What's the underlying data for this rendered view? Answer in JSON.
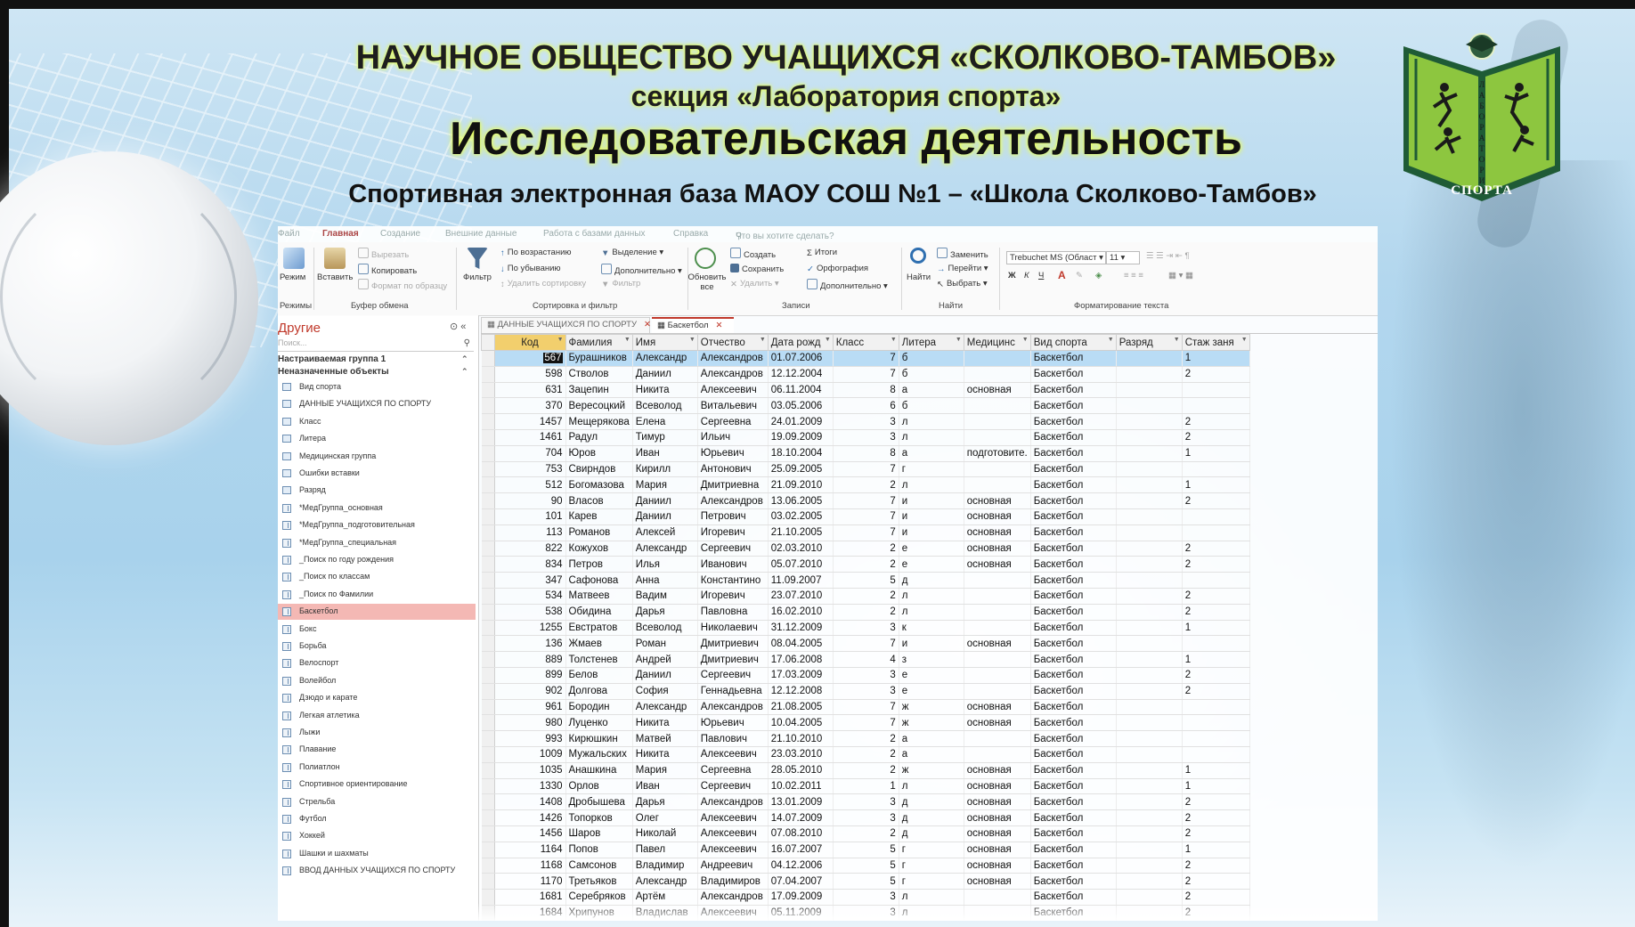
{
  "titles": {
    "line1": "НАУЧНОЕ ОБЩЕСТВО УЧАЩИХСЯ «СКОЛКОВО-ТАМБОВ»",
    "line2": "секция «Лаборатория спорта»",
    "line3": "Исследовательская деятельность",
    "line4": "Спортивная электронная база МАОУ СОШ №1 – «Школа Сколково-Тамбов»"
  },
  "logo": {
    "caption": "СПОРТА",
    "vertical_text": "ЛАБОРАТОРИЯ"
  },
  "ribbon": {
    "tabs": [
      "Файл",
      "Главная",
      "Создание",
      "Внешние данные",
      "Работа с базами данных",
      "Справка",
      "Что вы хотите сделать?"
    ],
    "active_tab": "Главная",
    "views": {
      "label": "Режим",
      "group": "Режимы"
    },
    "clipboard": {
      "paste": "Вставить",
      "cut": "Вырезать",
      "copy": "Копировать",
      "format": "Формат по образцу",
      "group": "Буфер обмена"
    },
    "sort": {
      "filter": "Фильтр",
      "asc": "По возрастанию",
      "desc": "По убыванию",
      "remove": "Удалить сортировку",
      "selection": "Выделение",
      "advanced": "Дополнительно",
      "toggle": "Фильтр",
      "group": "Сортировка и фильтр"
    },
    "records": {
      "refresh": "Обновить все",
      "new": "Создать",
      "save": "Сохранить",
      "delete": "Удалить",
      "totals": "Итоги",
      "spelling": "Орфография",
      "more": "Дополнительно",
      "group": "Записи"
    },
    "find": {
      "find": "Найти",
      "replace": "Заменить",
      "goto": "Перейти",
      "select": "Выбрать",
      "group": "Найти"
    },
    "text": {
      "font": "Trebuchet MS (Област",
      "size": "11",
      "bold": "Ж",
      "italic": "К",
      "underline": "Ч",
      "group": "Форматирование текста"
    }
  },
  "nav": {
    "title": "Другие",
    "search_placeholder": "Поиск...",
    "groups": [
      "Настраиваемая группа 1",
      "Неназначенные объекты"
    ],
    "items": [
      {
        "label": "Вид спорта",
        "kind": "table"
      },
      {
        "label": "ДАННЫЕ УЧАЩИХСЯ ПО СПОРТУ",
        "kind": "table"
      },
      {
        "label": "Класс",
        "kind": "table"
      },
      {
        "label": "Литера",
        "kind": "table"
      },
      {
        "label": "Медицинская группа",
        "kind": "table"
      },
      {
        "label": "Ошибки вставки",
        "kind": "table"
      },
      {
        "label": "Разряд",
        "kind": "table"
      },
      {
        "label": "*МедГруппа_основная",
        "kind": "query"
      },
      {
        "label": "*МедГруппа_подготовительная",
        "kind": "query"
      },
      {
        "label": "*МедГруппа_специальная",
        "kind": "query"
      },
      {
        "label": "_Поиск по году рождения",
        "kind": "query"
      },
      {
        "label": "_Поиск по классам",
        "kind": "query"
      },
      {
        "label": "_Поиск по Фамилии",
        "kind": "query"
      },
      {
        "label": "Баскетбол",
        "kind": "query",
        "selected": true
      },
      {
        "label": "Бокс",
        "kind": "query"
      },
      {
        "label": "Борьба",
        "kind": "query"
      },
      {
        "label": "Велоспорт",
        "kind": "query"
      },
      {
        "label": "Волейбол",
        "kind": "query"
      },
      {
        "label": "Дзюдо и карате",
        "kind": "query"
      },
      {
        "label": "Легкая атлетика",
        "kind": "query"
      },
      {
        "label": "Лыжи",
        "kind": "query"
      },
      {
        "label": "Плавание",
        "kind": "query"
      },
      {
        "label": "Полиатлон",
        "kind": "query"
      },
      {
        "label": "Спортивное ориентирование",
        "kind": "query"
      },
      {
        "label": "Стрельба",
        "kind": "query"
      },
      {
        "label": "Футбол",
        "kind": "query"
      },
      {
        "label": "Хоккей",
        "kind": "query"
      },
      {
        "label": "Шашки и шахматы",
        "kind": "query"
      },
      {
        "label": "ВВОД ДАННЫХ УЧАЩИХСЯ ПО СПОРТУ",
        "kind": "query"
      }
    ]
  },
  "doc_tabs": [
    {
      "label": "ДАННЫЕ УЧАЩИХСЯ ПО СПОРТУ",
      "active": false
    },
    {
      "label": "Баскетбол",
      "active": true
    }
  ],
  "grid": {
    "columns": [
      "Код",
      "Фамилия",
      "Имя",
      "Отчество",
      "Дата рожд",
      "Класс",
      "Литера",
      "Медицинс",
      "Вид спорта",
      "Разряд",
      "Стаж заня"
    ],
    "rows": [
      [
        "567",
        "Бурашников",
        "Александр",
        "Александров",
        "01.07.2006",
        "7",
        "б",
        "",
        "Баскетбол",
        "",
        "1"
      ],
      [
        "598",
        "Стволов",
        "Даниил",
        "Александров",
        "12.12.2004",
        "7",
        "б",
        "",
        "Баскетбол",
        "",
        "2"
      ],
      [
        "631",
        "Зацепин",
        "Никита",
        "Алексеевич",
        "06.11.2004",
        "8",
        "а",
        "основная",
        "Баскетбол",
        "",
        ""
      ],
      [
        "370",
        "Вересоцкий",
        "Всеволод",
        "Витальевич",
        "03.05.2006",
        "6",
        "б",
        "",
        "Баскетбол",
        "",
        ""
      ],
      [
        "1457",
        "Мещерякова",
        "Елена",
        "Сергеевна",
        "24.01.2009",
        "3",
        "л",
        "",
        "Баскетбол",
        "",
        "2"
      ],
      [
        "1461",
        "Радул",
        "Тимур",
        "Ильич",
        "19.09.2009",
        "3",
        "л",
        "",
        "Баскетбол",
        "",
        "2"
      ],
      [
        "704",
        "Юров",
        "Иван",
        "Юрьевич",
        "18.10.2004",
        "8",
        "а",
        "подготовите.",
        "Баскетбол",
        "",
        "1"
      ],
      [
        "753",
        "Свирндов",
        "Кирилл",
        "Антонович",
        "25.09.2005",
        "7",
        "г",
        "",
        "Баскетбол",
        "",
        ""
      ],
      [
        "512",
        "Богомазова",
        "Мария",
        "Дмитриевна",
        "21.09.2010",
        "2",
        "л",
        "",
        "Баскетбол",
        "",
        "1"
      ],
      [
        "90",
        "Власов",
        "Даниил",
        "Александров",
        "13.06.2005",
        "7",
        "и",
        "основная",
        "Баскетбол",
        "",
        "2"
      ],
      [
        "101",
        "Карев",
        "Даниил",
        "Петрович",
        "03.02.2005",
        "7",
        "и",
        "основная",
        "Баскетбол",
        "",
        ""
      ],
      [
        "113",
        "Романов",
        "Алексей",
        "Игоревич",
        "21.10.2005",
        "7",
        "и",
        "основная",
        "Баскетбол",
        "",
        ""
      ],
      [
        "822",
        "Кожухов",
        "Александр",
        "Сергеевич",
        "02.03.2010",
        "2",
        "е",
        "основная",
        "Баскетбол",
        "",
        "2"
      ],
      [
        "834",
        "Петров",
        "Илья",
        "Иванович",
        "05.07.2010",
        "2",
        "е",
        "основная",
        "Баскетбол",
        "",
        "2"
      ],
      [
        "347",
        "Сафонова",
        "Анна",
        "Константино",
        "11.09.2007",
        "5",
        "д",
        "",
        "Баскетбол",
        "",
        ""
      ],
      [
        "534",
        "Матвеев",
        "Вадим",
        "Игоревич",
        "23.07.2010",
        "2",
        "л",
        "",
        "Баскетбол",
        "",
        "2"
      ],
      [
        "538",
        "Обидина",
        "Дарья",
        "Павловна",
        "16.02.2010",
        "2",
        "л",
        "",
        "Баскетбол",
        "",
        "2"
      ],
      [
        "1255",
        "Евстратов",
        "Всеволод",
        "Николаевич",
        "31.12.2009",
        "3",
        "к",
        "",
        "Баскетбол",
        "",
        "1"
      ],
      [
        "136",
        "Жмаев",
        "Роман",
        "Дмитриевич",
        "08.04.2005",
        "7",
        "и",
        "основная",
        "Баскетбол",
        "",
        ""
      ],
      [
        "889",
        "Толстенев",
        "Андрей",
        "Дмитриевич",
        "17.06.2008",
        "4",
        "з",
        "",
        "Баскетбол",
        "",
        "1"
      ],
      [
        "899",
        "Белов",
        "Даниил",
        "Сергеевич",
        "17.03.2009",
        "3",
        "е",
        "",
        "Баскетбол",
        "",
        "2"
      ],
      [
        "902",
        "Долгова",
        "София",
        "Геннадьевна",
        "12.12.2008",
        "3",
        "е",
        "",
        "Баскетбол",
        "",
        "2"
      ],
      [
        "961",
        "Бородин",
        "Александр",
        "Александров",
        "21.08.2005",
        "7",
        "ж",
        "основная",
        "Баскетбол",
        "",
        ""
      ],
      [
        "980",
        "Луценко",
        "Никита",
        "Юрьевич",
        "10.04.2005",
        "7",
        "ж",
        "основная",
        "Баскетбол",
        "",
        ""
      ],
      [
        "993",
        "Кирюшкин",
        "Матвей",
        "Павлович",
        "21.10.2010",
        "2",
        "а",
        "",
        "Баскетбол",
        "",
        ""
      ],
      [
        "1009",
        "Мужальских",
        "Никита",
        "Алексеевич",
        "23.03.2010",
        "2",
        "а",
        "",
        "Баскетбол",
        "",
        ""
      ],
      [
        "1035",
        "Анашкина",
        "Мария",
        "Сергеевна",
        "28.05.2010",
        "2",
        "ж",
        "основная",
        "Баскетбол",
        "",
        "1"
      ],
      [
        "1330",
        "Орлов",
        "Иван",
        "Сергеевич",
        "10.02.2011",
        "1",
        "л",
        "основная",
        "Баскетбол",
        "",
        "1"
      ],
      [
        "1408",
        "Дробышева",
        "Дарья",
        "Александров",
        "13.01.2009",
        "3",
        "д",
        "основная",
        "Баскетбол",
        "",
        "2"
      ],
      [
        "1426",
        "Топорков",
        "Олег",
        "Алексеевич",
        "14.07.2009",
        "3",
        "д",
        "основная",
        "Баскетбол",
        "",
        "2"
      ],
      [
        "1456",
        "Шаров",
        "Николай",
        "Алексеевич",
        "07.08.2010",
        "2",
        "д",
        "основная",
        "Баскетбол",
        "",
        "2"
      ],
      [
        "1164",
        "Попов",
        "Павел",
        "Алексеевич",
        "16.07.2007",
        "5",
        "г",
        "основная",
        "Баскетбол",
        "",
        "1"
      ],
      [
        "1168",
        "Самсонов",
        "Владимир",
        "Андреевич",
        "04.12.2006",
        "5",
        "г",
        "основная",
        "Баскетбол",
        "",
        "2"
      ],
      [
        "1170",
        "Третьяков",
        "Александр",
        "Владимиров",
        "07.04.2007",
        "5",
        "г",
        "основная",
        "Баскетбол",
        "",
        "2"
      ],
      [
        "1681",
        "Серебряков",
        "Артём",
        "Александров",
        "17.09.2009",
        "3",
        "л",
        "",
        "Баскетбол",
        "",
        "2"
      ],
      [
        "1684",
        "Хрипунов",
        "Владислав",
        "Алексеевич",
        "05.11.2009",
        "3",
        "л",
        "",
        "Баскетбол",
        "",
        "2"
      ]
    ],
    "current_row": 0
  },
  "colors": {
    "accent": "#c0392b",
    "title_glow": "#e7ff5a",
    "selected_row": "#b9dcf5",
    "selected_nav": "#f4b8b4",
    "key_header": "#f2cf6d",
    "logo_green": "#8dc63f",
    "logo_dark": "#1f5b36"
  }
}
